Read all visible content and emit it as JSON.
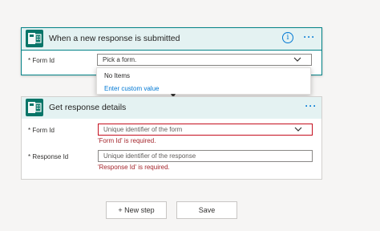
{
  "trigger_card": {
    "title": "When a new response is submitted",
    "icon": "forms-app-icon",
    "form_id_label": "* Form Id",
    "form_id_value": "Pick a form."
  },
  "dropdown": {
    "items": [
      "No Items",
      "Enter custom value"
    ]
  },
  "action_card": {
    "title": "Get response details",
    "icon": "forms-app-icon",
    "form_id_label": "* Form Id",
    "form_id_placeholder": "Unique identifier of the form",
    "form_id_error": "'Form Id' is required.",
    "response_id_label": "* Response Id",
    "response_id_placeholder": "Unique identifier of the response",
    "response_id_error": "'Response Id' is required."
  },
  "buttons": {
    "new_step": "+ New step",
    "save": "Save"
  },
  "colors": {
    "accent": "#0078d4",
    "teal": "#038387",
    "header_bg": "#e4f2f2",
    "error": "#a4262c"
  }
}
